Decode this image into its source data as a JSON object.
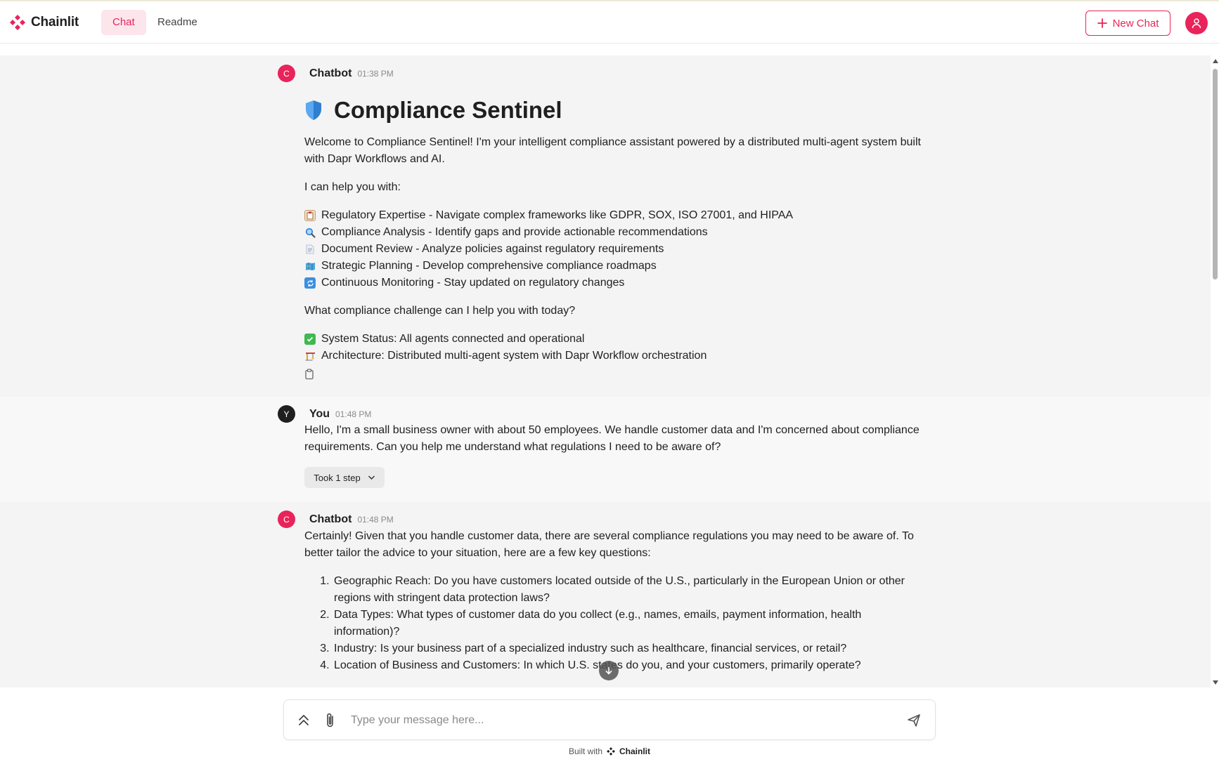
{
  "header": {
    "logo_text": "Chainlit",
    "tabs": [
      {
        "label": "Chat"
      },
      {
        "label": "Readme"
      }
    ],
    "new_chat_label": "New Chat",
    "accent": "#e8245a"
  },
  "messages": [
    {
      "author": "Chatbot",
      "avatar": "C",
      "time": "01:38 PM",
      "title": "Compliance Sentinel",
      "intro": "Welcome to Compliance Sentinel! I'm your intelligent compliance assistant powered by a distributed multi-agent system built with Dapr Workflows and AI.",
      "help_intro": "I can help you with:",
      "features": [
        {
          "icon": "clipboard-icon",
          "text": "Regulatory Expertise - Navigate complex frameworks like GDPR, SOX, ISO 27001, and HIPAA"
        },
        {
          "icon": "magnifier-icon",
          "text": "Compliance Analysis - Identify gaps and provide actionable recommendations"
        },
        {
          "icon": "document-icon",
          "text": "Document Review - Analyze policies against regulatory requirements"
        },
        {
          "icon": "map-icon",
          "text": "Strategic Planning - Develop comprehensive compliance roadmaps"
        },
        {
          "icon": "refresh-icon",
          "text": "Continuous Monitoring - Stay updated on regulatory changes"
        }
      ],
      "question": "What compliance challenge can I help you with today?",
      "status": [
        {
          "icon": "check-icon",
          "text": "System Status: All agents connected and operational"
        },
        {
          "icon": "construction-icon",
          "text": "Architecture: Distributed multi-agent system with Dapr Workflow orchestration"
        }
      ]
    },
    {
      "author": "You",
      "avatar": "Y",
      "time": "01:48 PM",
      "text": "Hello, I'm a small business owner with about 50 employees. We handle customer data and I'm concerned about compliance requirements. Can you help me understand what regulations I need to be aware of?",
      "steps_label": "Took 1 step"
    },
    {
      "author": "Chatbot",
      "avatar": "C",
      "time": "01:48 PM",
      "text": "Certainly! Given that you handle customer data, there are several compliance regulations you may need to be aware of. To better tailor the advice to your situation, here are a few key questions:",
      "questions": [
        "Geographic Reach: Do you have customers located outside of the U.S., particularly in the European Union or other regions with stringent data protection laws?",
        "Data Types: What types of customer data do you collect (e.g., names, emails, payment information, health information)?",
        "Industry: Is your business part of a specialized industry such as healthcare, financial services, or retail?",
        "Location of Business and Customers: In which U.S. states do you, and your customers, primarily operate?"
      ]
    }
  ],
  "composer": {
    "placeholder": "Type your message here..."
  },
  "footer": {
    "built_with": "Built with",
    "brand": "Chainlit"
  }
}
